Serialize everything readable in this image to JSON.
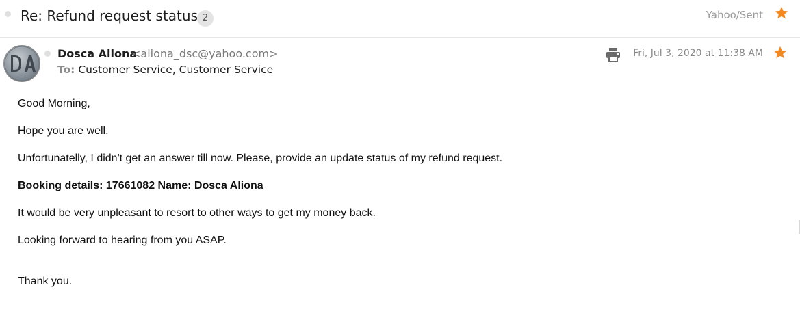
{
  "header": {
    "subject": "Re: Refund request status",
    "count": "2",
    "folder": "Yahoo/Sent",
    "star_icon": "star-icon",
    "star_color": "#f5881f"
  },
  "message": {
    "sender_name": "Dosca Aliona",
    "sender_email": "<aliona_dsc@yahoo.com>",
    "avatar_initials": "DA",
    "to_label": "To:",
    "to_names": "Customer Service,  Customer Service",
    "date": "Fri, Jul 3, 2020 at 11:38 AM",
    "print_icon": "print-icon"
  },
  "body": {
    "lines": [
      "Good Morning,",
      "Hope you are well.",
      "Unfortunatelly, I didn't get an answer till now. Please, provide an update status of my refund request.",
      "Booking details: 17661082 Name: Dosca Aliona",
      "It would be very unpleasant to resort to other ways to get my money back.",
      "Looking forward to hearing from you ASAP.",
      "Thank you."
    ]
  }
}
